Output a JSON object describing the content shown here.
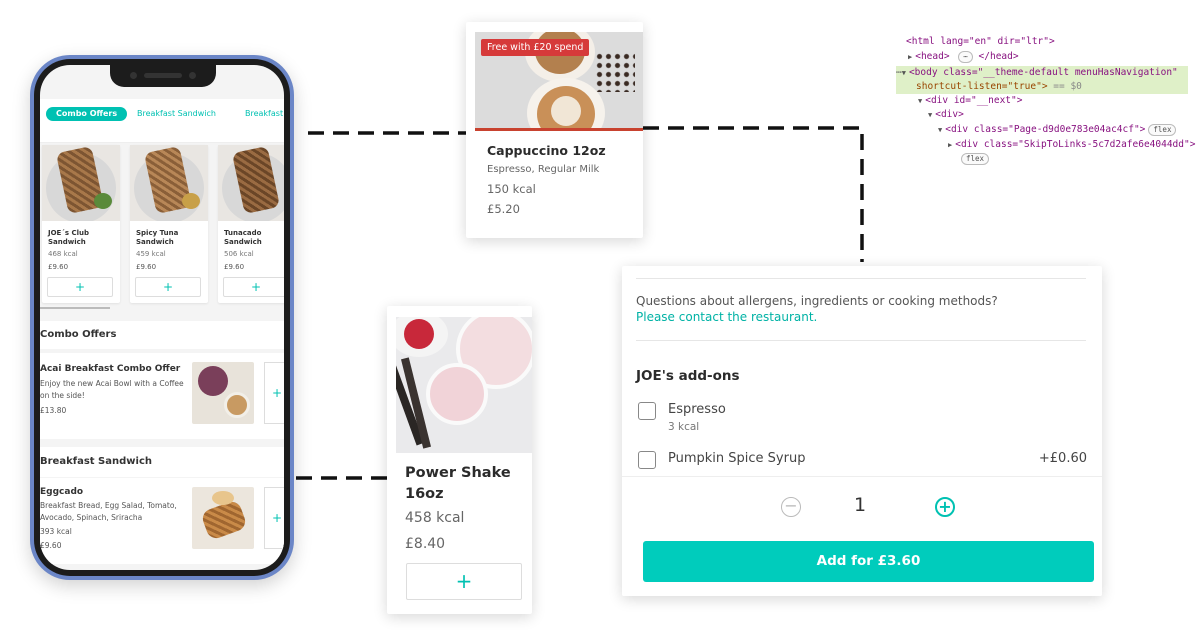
{
  "colors": {
    "accent": "#00ccbc",
    "link": "#00b2a5",
    "badge": "#d63a3a",
    "phone_frame": "#6b86c7",
    "devtools_highlight": "#dff0c8"
  },
  "phone": {
    "tabs": [
      {
        "label": "Combo Offers",
        "active": true
      },
      {
        "label": "Breakfast Sandwich",
        "active": false
      },
      {
        "label": "Breakfast B",
        "active": false
      }
    ],
    "products": [
      {
        "name": "JOE´s Club Sandwich",
        "kcal": "468 kcal",
        "price": "£9.60",
        "add": "+"
      },
      {
        "name": "Spicy Tuna Sandwich",
        "kcal": "459 kcal",
        "price": "£9.60",
        "add": "+"
      },
      {
        "name": "Tunacado Sandwich",
        "kcal": "506 kcal",
        "price": "£9.60",
        "add": "+"
      }
    ],
    "sections": [
      {
        "title": "Combo Offers",
        "item": {
          "name": "Acai Breakfast Combo Offer",
          "desc": "Enjoy the new Acai Bowl with a Coffee on the side!",
          "price": "£13.80",
          "add": "+"
        }
      },
      {
        "title": "Breakfast Sandwich",
        "item": {
          "name": "Eggcado",
          "desc": "Breakfast Bread, Egg Salad, Tomato, Avocado, Spinach, Sriracha",
          "kcal": "393 kcal",
          "price": "£9.60",
          "add": "+"
        }
      }
    ]
  },
  "cappuccino_card": {
    "badge": "Free with £20 spend",
    "title": "Cappuccino 12oz",
    "desc": "Espresso, Regular Milk",
    "kcal": "150 kcal",
    "price": "£5.20"
  },
  "shake_card": {
    "title": "Power Shake 16oz",
    "kcal": "458 kcal",
    "price": "£8.40",
    "add": "+"
  },
  "devtools": {
    "line1": "<html lang=\"en\" dir=\"ltr\">",
    "line2": "<head>",
    "line2_ellipsis": "⋯",
    "line2_end": "</head>",
    "line3_dots": "⋯",
    "line3": "<body class=\"__theme-default menuHasNavigation\"",
    "line4": "shortcut-listen=\"true\">",
    "line4_eq": "== $0",
    "line5": "<div id=\"__next\">",
    "line6": "<div>",
    "line7": "<div class=\"Page-d9d0e783e04ac4cf\">",
    "line7_pill": "flex",
    "line8": "<div class=\"SkipToLinks-5c7d2afe6e4044dd\">",
    "line9_pill": "flex"
  },
  "addons_panel": {
    "question": "Questions about allergens, ingredients or cooking methods?",
    "contact_link": "Please contact the restaurant.",
    "title": "JOE's add-ons",
    "options": [
      {
        "name": "Espresso",
        "kcal": "3 kcal",
        "price": ""
      },
      {
        "name": "Pumpkin Spice Syrup",
        "kcal": "",
        "price": "+£0.60"
      }
    ],
    "minus": "−",
    "quantity": "1",
    "plus": "+",
    "cta": "Add for £3.60"
  }
}
